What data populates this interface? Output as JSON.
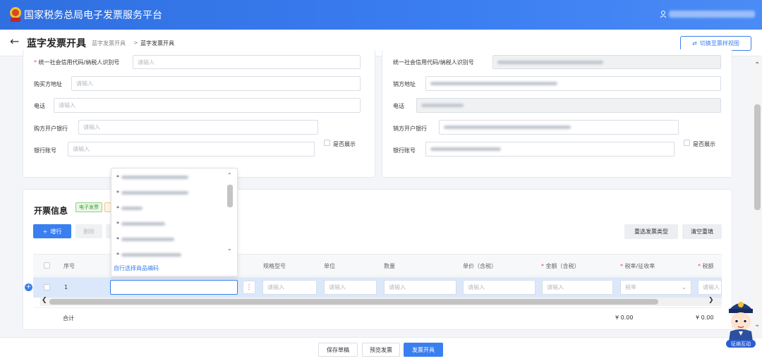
{
  "header": {
    "app_title": "国家税务总局电子发票服务平台"
  },
  "titlebar": {
    "page_title": "蓝字发票开具",
    "breadcrumb_1": "蓝字发票开具",
    "breadcrumb_sep": ">",
    "breadcrumb_2": "蓝字发票开具",
    "switch_label": "切换至票样视图"
  },
  "buyer": {
    "taxid_label": "统一社会信用代码/纳税人识别号",
    "taxid_placeholder": "请输入",
    "address_label": "购买方地址",
    "address_placeholder": "请输入",
    "phone_label": "电话",
    "phone_placeholder": "请输入",
    "bank_label": "购方开户银行",
    "bank_placeholder": "请输入",
    "account_label": "银行账号",
    "account_placeholder": "请输入",
    "show_label": "是否展示"
  },
  "seller": {
    "taxid_label": "统一社会信用代码/纳税人识别号",
    "address_label": "销方地址",
    "phone_label": "电话",
    "bank_label": "销方开户银行",
    "account_label": "银行账号",
    "show_label": "是否展示"
  },
  "invoice": {
    "section_title": "开票信息",
    "tag_electronic": "电子发票",
    "add_row": "增行",
    "delete": "删除",
    "reselect_type": "重选发票类型",
    "clear_refill": "清空重填"
  },
  "table": {
    "col_seq": "序号",
    "col_spec": "规格型号",
    "col_unit": "单位",
    "col_qty": "数量",
    "col_price": "单价（含税）",
    "col_amount": "金额（含税）",
    "col_rate": "税率/征收率",
    "col_tax": "税额",
    "row_seq": "1",
    "placeholder": "请输入",
    "rate_placeholder": "税率",
    "total_label": "合计",
    "total_amount": "¥ 0.00",
    "total_tax": "¥ 0.00"
  },
  "dropdown": {
    "custom_select": "自行选择商品编码"
  },
  "footer": {
    "save_draft": "保存草稿",
    "preview": "预览发票",
    "issue": "发票开具"
  },
  "assistant": {
    "label": "征纳互动"
  },
  "colors": {
    "brand": "#3a7ff0",
    "required": "#e34d4d"
  }
}
